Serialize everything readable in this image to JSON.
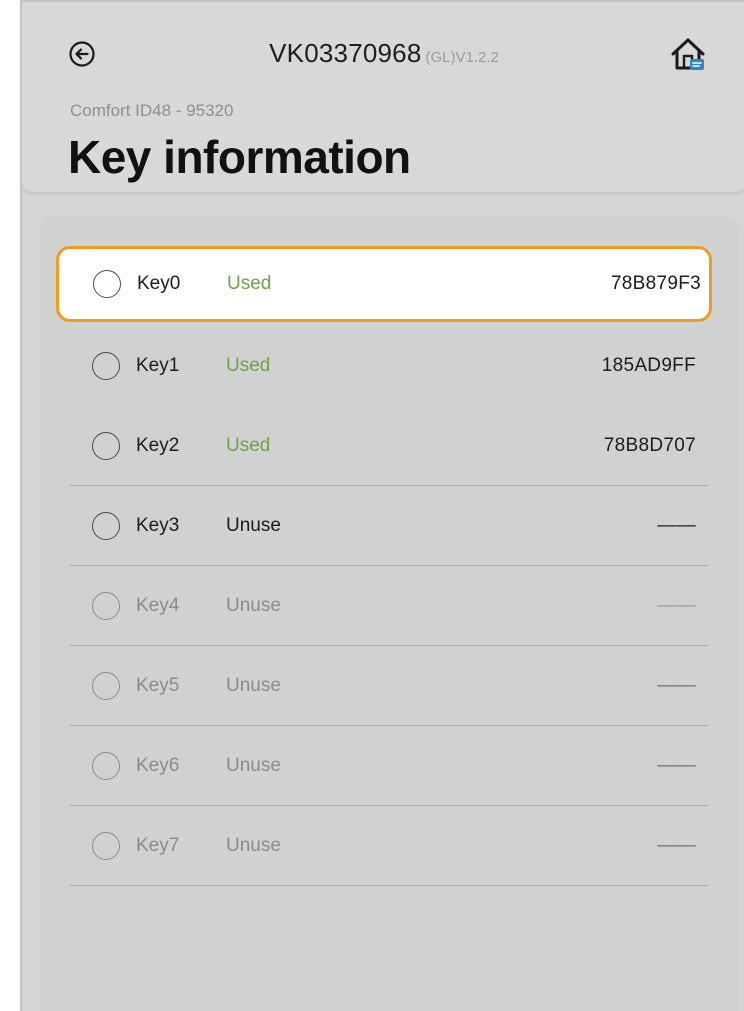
{
  "header": {
    "device_id": "VK03370968",
    "version": "(GL)V1.2.2",
    "back_icon": "arrow-left-circle-icon",
    "home_icon": "home-icon",
    "subtitle": "Comfort ID48 - 95320",
    "title": "Key information"
  },
  "colors": {
    "accent_selected": "#f29c1f",
    "status_used": "#6fa33e",
    "home_badge": "#2e86c9"
  },
  "keys": [
    {
      "name": "Key0",
      "status": "Used",
      "value": "78B879F3",
      "selected": true
    },
    {
      "name": "Key1",
      "status": "Used",
      "value": "185AD9FF"
    },
    {
      "name": "Key2",
      "status": "Used",
      "value": "78B8D707"
    },
    {
      "name": "Key3",
      "status": "Unuse",
      "value": "——"
    },
    {
      "name": "Key4",
      "status": "Unuse",
      "value": "——"
    },
    {
      "name": "Key5",
      "status": "Unuse",
      "value": "——"
    },
    {
      "name": "Key6",
      "status": "Unuse",
      "value": "——"
    },
    {
      "name": "Key7",
      "status": "Unuse",
      "value": "——"
    }
  ]
}
